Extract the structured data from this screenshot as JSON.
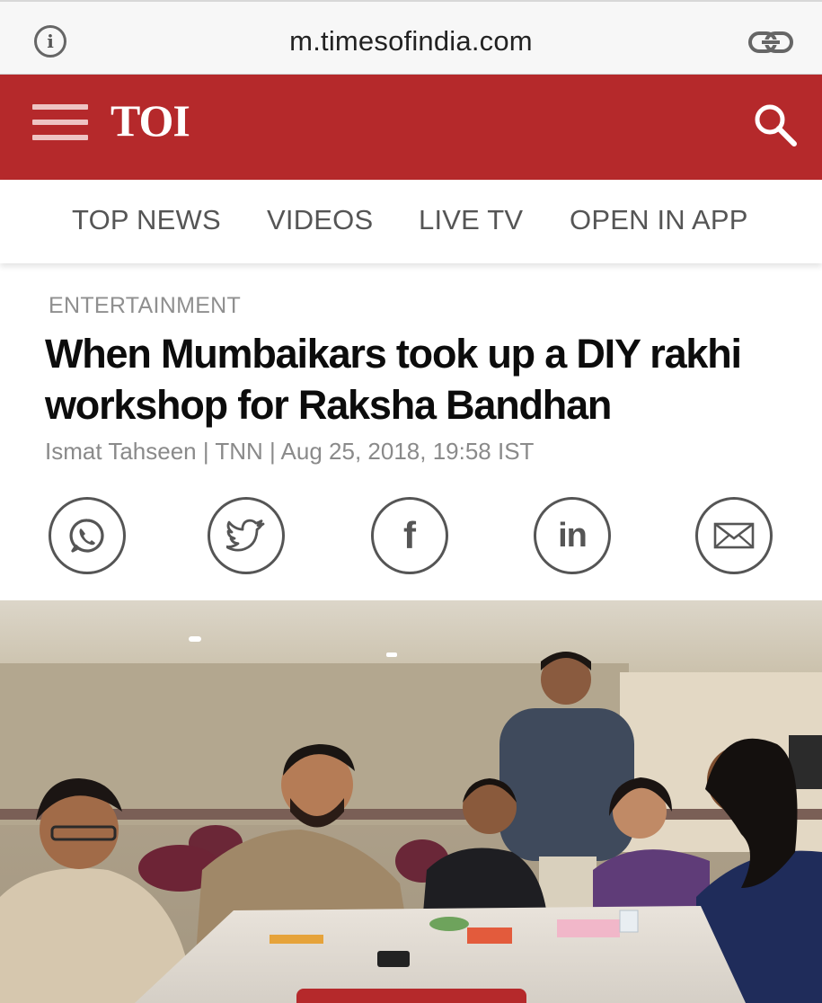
{
  "browser": {
    "url": "m.timesofindia.com",
    "icons": [
      "info-icon",
      "link-icon"
    ]
  },
  "header": {
    "logo": "TOI",
    "bg_color": "#b5292b",
    "icons": [
      "hamburger-menu-icon",
      "search-icon"
    ]
  },
  "nav": {
    "tabs": [
      "TOP NEWS",
      "VIDEOS",
      "LIVE TV",
      "OPEN IN APP"
    ]
  },
  "article": {
    "section": "ENTERTAINMENT",
    "headline_line1": "When Mumbaikars took up a DIY rakhi",
    "headline_line2": "workshop for Raksha Bandhan",
    "byline": "Ismat Tahseen | TNN | Aug 25, 2018, 19:58 IST"
  },
  "share": {
    "buttons": [
      {
        "icon": "whatsapp-icon"
      },
      {
        "icon": "twitter-icon"
      },
      {
        "icon": "facebook-icon",
        "label": "f"
      },
      {
        "icon": "linkedin-icon",
        "label": "in"
      },
      {
        "icon": "email-icon"
      }
    ]
  },
  "photo": {
    "icon": "article-photo"
  }
}
